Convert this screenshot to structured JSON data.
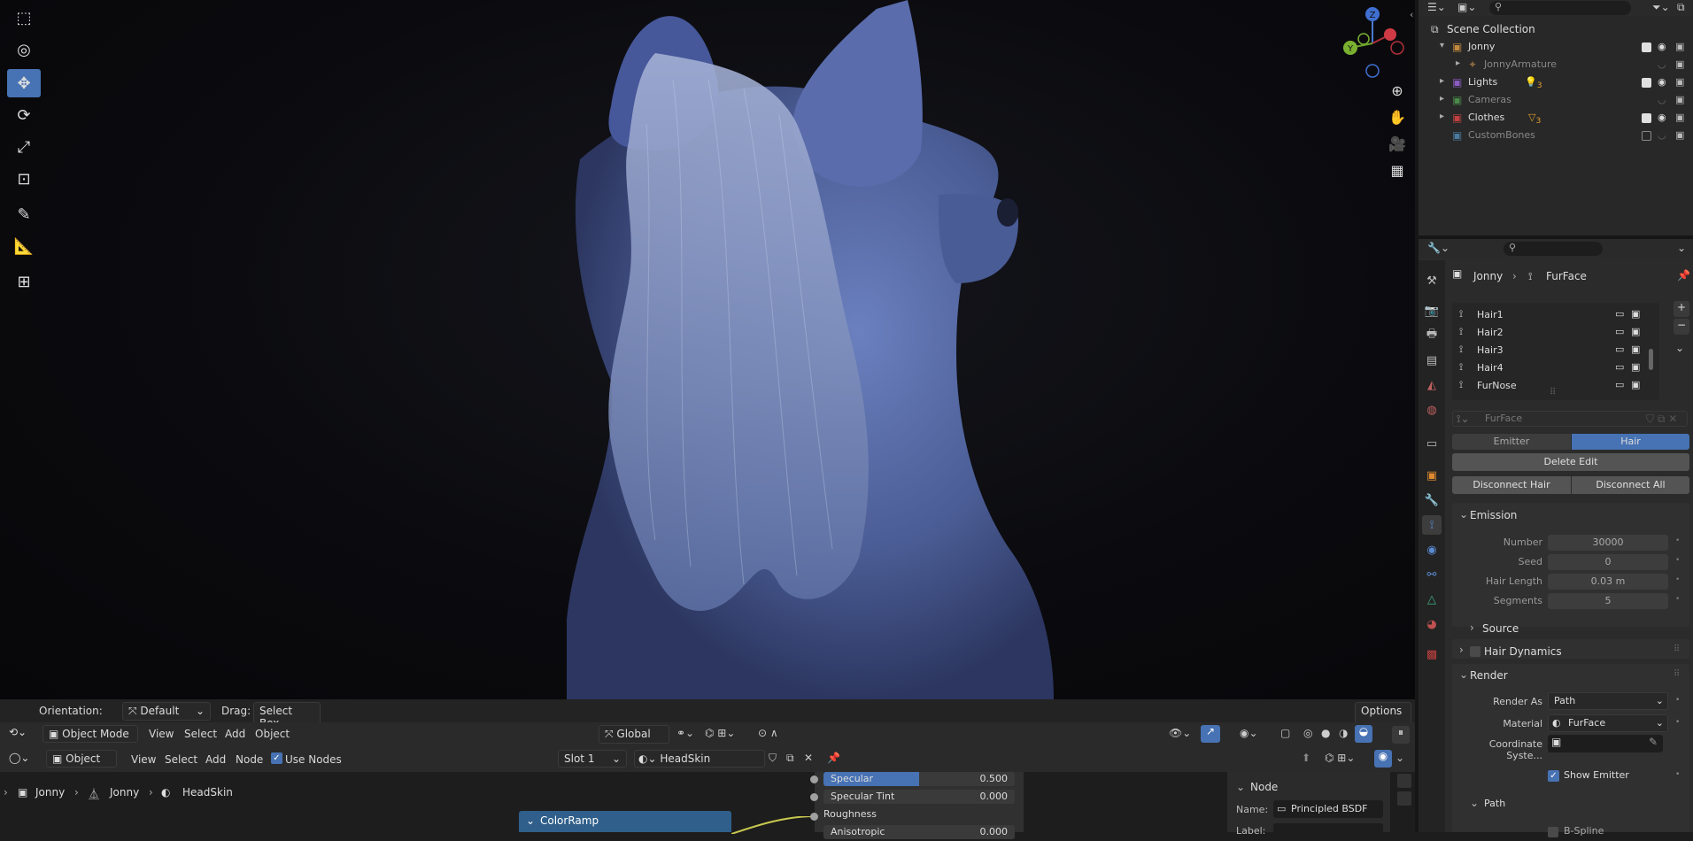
{
  "viewport": {
    "tools": [
      "select-box-icon",
      "cursor-icon",
      "move-icon",
      "rotate-icon",
      "scale-icon",
      "transform-icon",
      "annotate-icon",
      "measure-icon",
      "add-cube-icon"
    ],
    "gizmo": {
      "z": "Z",
      "y": "Y"
    },
    "header": {
      "orientation_label": "Orientation:",
      "orientation_value": "Default",
      "drag_label": "Drag:",
      "drag_value": "Select Box",
      "options": "Options"
    },
    "mode_bar": {
      "mode": "Object Mode",
      "menus": [
        "View",
        "Select",
        "Add",
        "Object"
      ],
      "transform": "Global"
    }
  },
  "node_editor": {
    "header": {
      "type": "Object",
      "menus": [
        "View",
        "Select",
        "Add",
        "Node"
      ],
      "use_nodes": "Use Nodes",
      "slot": "Slot 1",
      "material": "HeadSkin"
    },
    "breadcrumb": [
      "Jonny",
      "Jonny",
      "HeadSkin"
    ],
    "colorramp": "ColorRamp",
    "bsdf_rows": [
      {
        "label": "Specular",
        "value": "0.500"
      },
      {
        "label": "Specular Tint",
        "value": "0.000"
      },
      {
        "label": "Roughness",
        "value": ""
      },
      {
        "label": "Anisotropic",
        "value": "0.000"
      }
    ],
    "side_panel": {
      "title": "Node",
      "name_label": "Name:",
      "name_value": "Principled BSDF",
      "label_label": "Label:"
    }
  },
  "outliner": {
    "root": "Scene Collection",
    "items": [
      {
        "name": "Jonny",
        "level": 1,
        "color": "#c08a3e"
      },
      {
        "name": "JonnyArmature",
        "level": 2,
        "color": "#8a6a40",
        "dim": true
      },
      {
        "name": "Lights",
        "level": 1,
        "color": "#8a5bc0"
      },
      {
        "name": "Cameras",
        "level": 1,
        "color": "#4a8a4a",
        "dim": true
      },
      {
        "name": "Clothes",
        "level": 1,
        "color": "#c04040"
      },
      {
        "name": "CustomBones",
        "level": 1,
        "color": "#4a7aa0",
        "dim": true
      }
    ],
    "badges": {
      "lights": "3",
      "clothes": "3"
    }
  },
  "properties": {
    "breadcrumb": {
      "object": "Jonny",
      "system": "FurFace"
    },
    "particle_list": [
      "Hair1",
      "Hair2",
      "Hair3",
      "Hair4",
      "FurNose"
    ],
    "settings_name": "FurFace",
    "type_tabs": [
      "Emitter",
      "Hair"
    ],
    "buttons": {
      "delete_edit": "Delete Edit",
      "disconnect_hair": "Disconnect Hair",
      "disconnect_all": "Disconnect All"
    },
    "emission": {
      "title": "Emission",
      "fields": [
        {
          "label": "Number",
          "value": "30000"
        },
        {
          "label": "Seed",
          "value": "0"
        },
        {
          "label": "Hair Length",
          "value": "0.03 m"
        },
        {
          "label": "Segments",
          "value": "5"
        }
      ],
      "source": "Source"
    },
    "hair_dynamics": "Hair Dynamics",
    "render": {
      "title": "Render",
      "render_as_label": "Render As",
      "render_as_value": "Path",
      "material_label": "Material",
      "material_value": "FurFace",
      "coord_label": "Coordinate Syste...",
      "show_emitter": "Show Emitter",
      "path": "Path",
      "bspline": "B-Spline"
    }
  },
  "colors": {
    "accent": "#4772b3",
    "figure": "#5a6ea8"
  }
}
